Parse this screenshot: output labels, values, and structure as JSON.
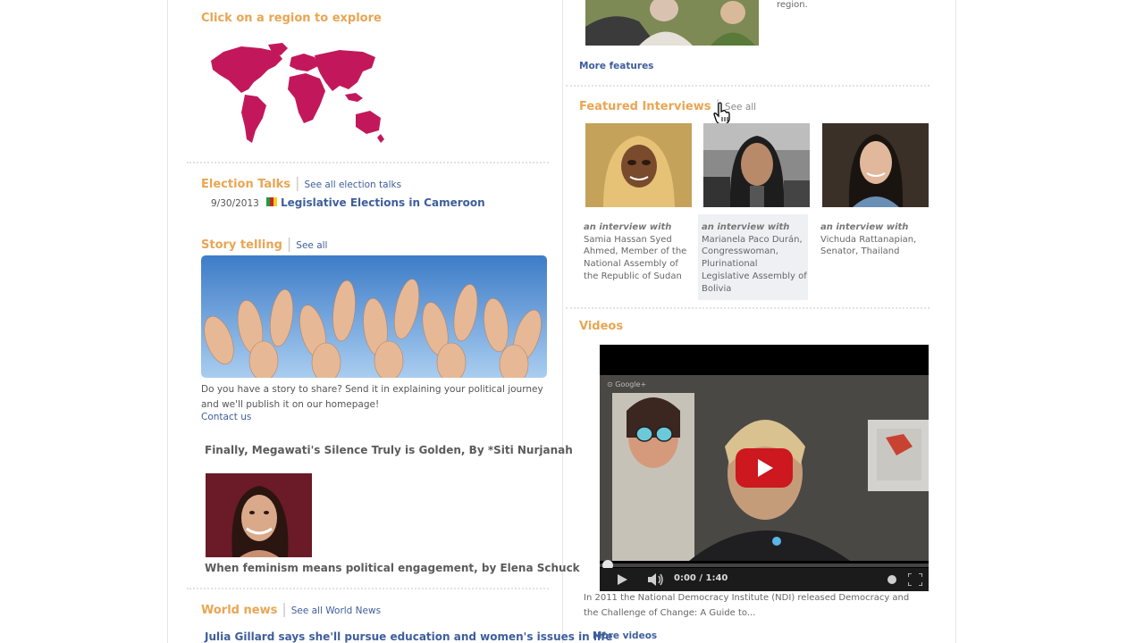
{
  "left": {
    "region_heading": "Click on a region to explore",
    "election_talks": {
      "heading": "Election Talks",
      "see_all": "See all election talks",
      "item_date": "9/30/2013",
      "item_title": "Legislative Elections in Cameroon"
    },
    "story_telling": {
      "heading": "Story telling",
      "see_all": "See all",
      "share_text": "Do you have a story to share? Send it in explaining your political journey and we'll publish it on our homepage!",
      "contact": "Contact us",
      "story1_title": "Finally, Megawati's Silence Truly is Golden, By *Siti Nurjanah",
      "story2_title": "When feminism means political engagement, by Elena Schuck"
    },
    "world_news": {
      "heading": "World news",
      "see_all": "See all World News",
      "item_title": "Julia Gillard says she'll pursue education and women's issues in life"
    }
  },
  "right": {
    "feature_tail": "region.",
    "more_features": "More features",
    "interviews": {
      "heading": "Featured Interviews",
      "see_all": "See all",
      "prefix": "an interview with",
      "items": [
        {
          "text": "Samia Hassan Syed Ahmed, Member of the National Assembly of the Republic of Sudan"
        },
        {
          "text": "Marianela Paco Durán, Congresswoman, Plurinational Legislative Assembly of Bolivia"
        },
        {
          "text": "Vichuda Rattanapian, Senator, Thailand"
        }
      ]
    },
    "videos": {
      "heading": "Videos",
      "time": "0:00 / 1:40",
      "description": "In 2011 the National Democracy Institute (NDI) released Democracy and the Challenge of Change: A Guide to...",
      "more": "More videos"
    }
  },
  "colors": {
    "accent_orange": "#e9a553",
    "link_blue": "#3e5e9c",
    "map_magenta": "#c2185b",
    "youtube_red": "#cc181e"
  }
}
